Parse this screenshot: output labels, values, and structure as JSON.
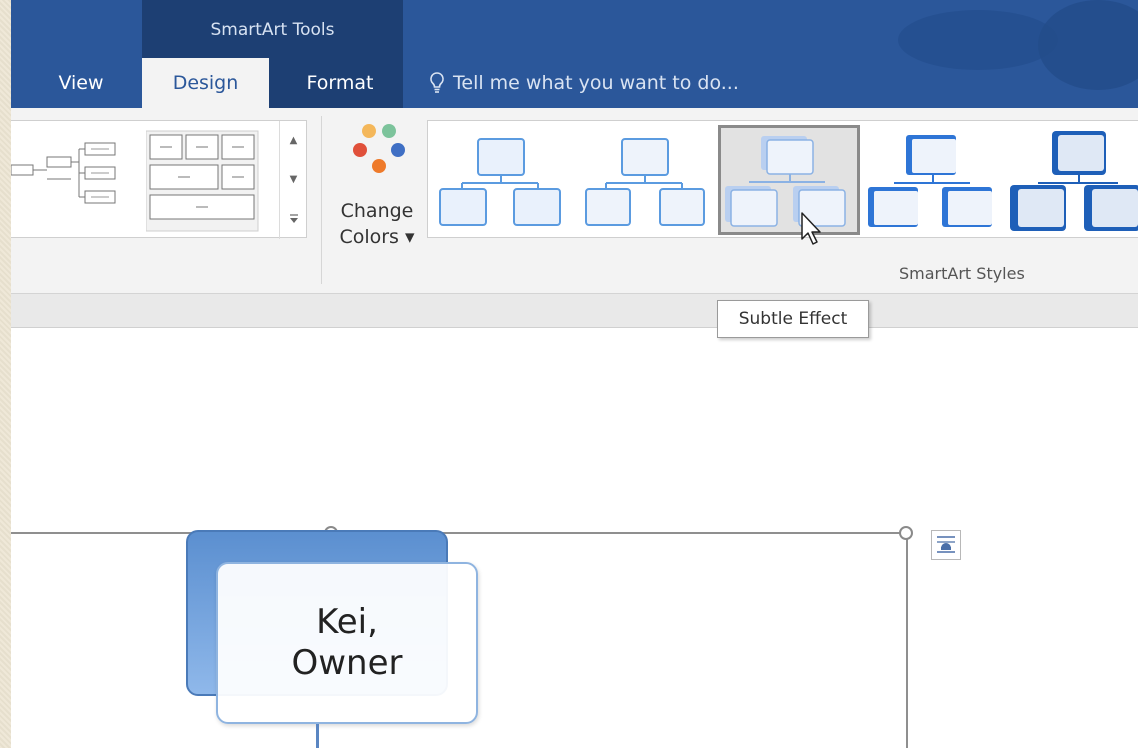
{
  "ribbon": {
    "context_title": "SmartArt Tools",
    "tabs": [
      {
        "label": "View"
      },
      {
        "label": "Design"
      },
      {
        "label": "Format"
      }
    ],
    "tell_me": "Tell me what you want to do...",
    "change_colors": {
      "line1": "Change",
      "line2": "Colors ▾"
    },
    "styles_group_label": "SmartArt Styles"
  },
  "tooltip": "Subtle Effect",
  "document": {
    "node_line1": "Kei,",
    "node_line2": "Owner"
  },
  "colors": {
    "accent": "#2b579a",
    "context_group": "#1d3f73",
    "ribbon_bg": "#f3f3f3"
  }
}
